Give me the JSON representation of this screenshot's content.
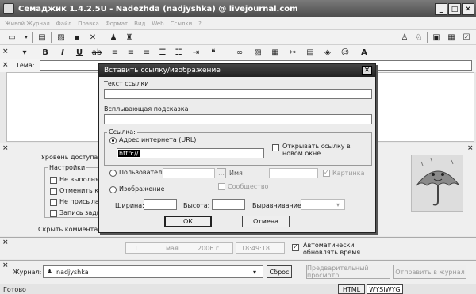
{
  "window": {
    "title": "Семаджик 1.4.2.5U - Nadezhda (nadjyshka) @ livejournal.com"
  },
  "menu": [
    "Живой Журнал",
    "Файл",
    "Правка",
    "Формат",
    "Вид",
    "Web",
    "Ссылки",
    "?"
  ],
  "subject": {
    "label": "Тема:",
    "value": ""
  },
  "access": {
    "label": "Уровень доступа:"
  },
  "settings": {
    "legend": "Настройки",
    "items": [
      "Не выполнять",
      "Отменить ком",
      "Не присылат",
      "Запись задни"
    ]
  },
  "hide_comments": "Скрыть комментари",
  "date": {
    "day": "1",
    "month": "мая",
    "year": "2006 г.",
    "time": "18:49:18",
    "auto_label": "Автоматически обновлять время"
  },
  "journal": {
    "label": "Журнал:",
    "value": "nadjyshka",
    "reset": "Сброс",
    "preview": "Предварительный просмотр",
    "send": "Отправить в журнал"
  },
  "status": {
    "left": "Готово",
    "html_tab": "HTML",
    "wysiwyg_tab": "WYSIWYG"
  },
  "dialog": {
    "title": "Вставить ссылку/изображение",
    "link_text_label": "Текст ссылки",
    "tooltip_label": "Всплывающая подсказка",
    "link_group": "Ссылка:",
    "url_radio": "Адрес интернета (URL)",
    "url_value": "http://",
    "new_window": "Открывать ссылку в новом окне",
    "user_radio": "Пользователь",
    "name_label": "Имя",
    "picture_label": "Картинка",
    "community_label": "Сообщество",
    "image_radio": "Изображение",
    "width_label": "Ширина:",
    "height_label": "Высота:",
    "align_label": "Выравнивание:",
    "ok": "ОК",
    "cancel": "Отмена"
  }
}
